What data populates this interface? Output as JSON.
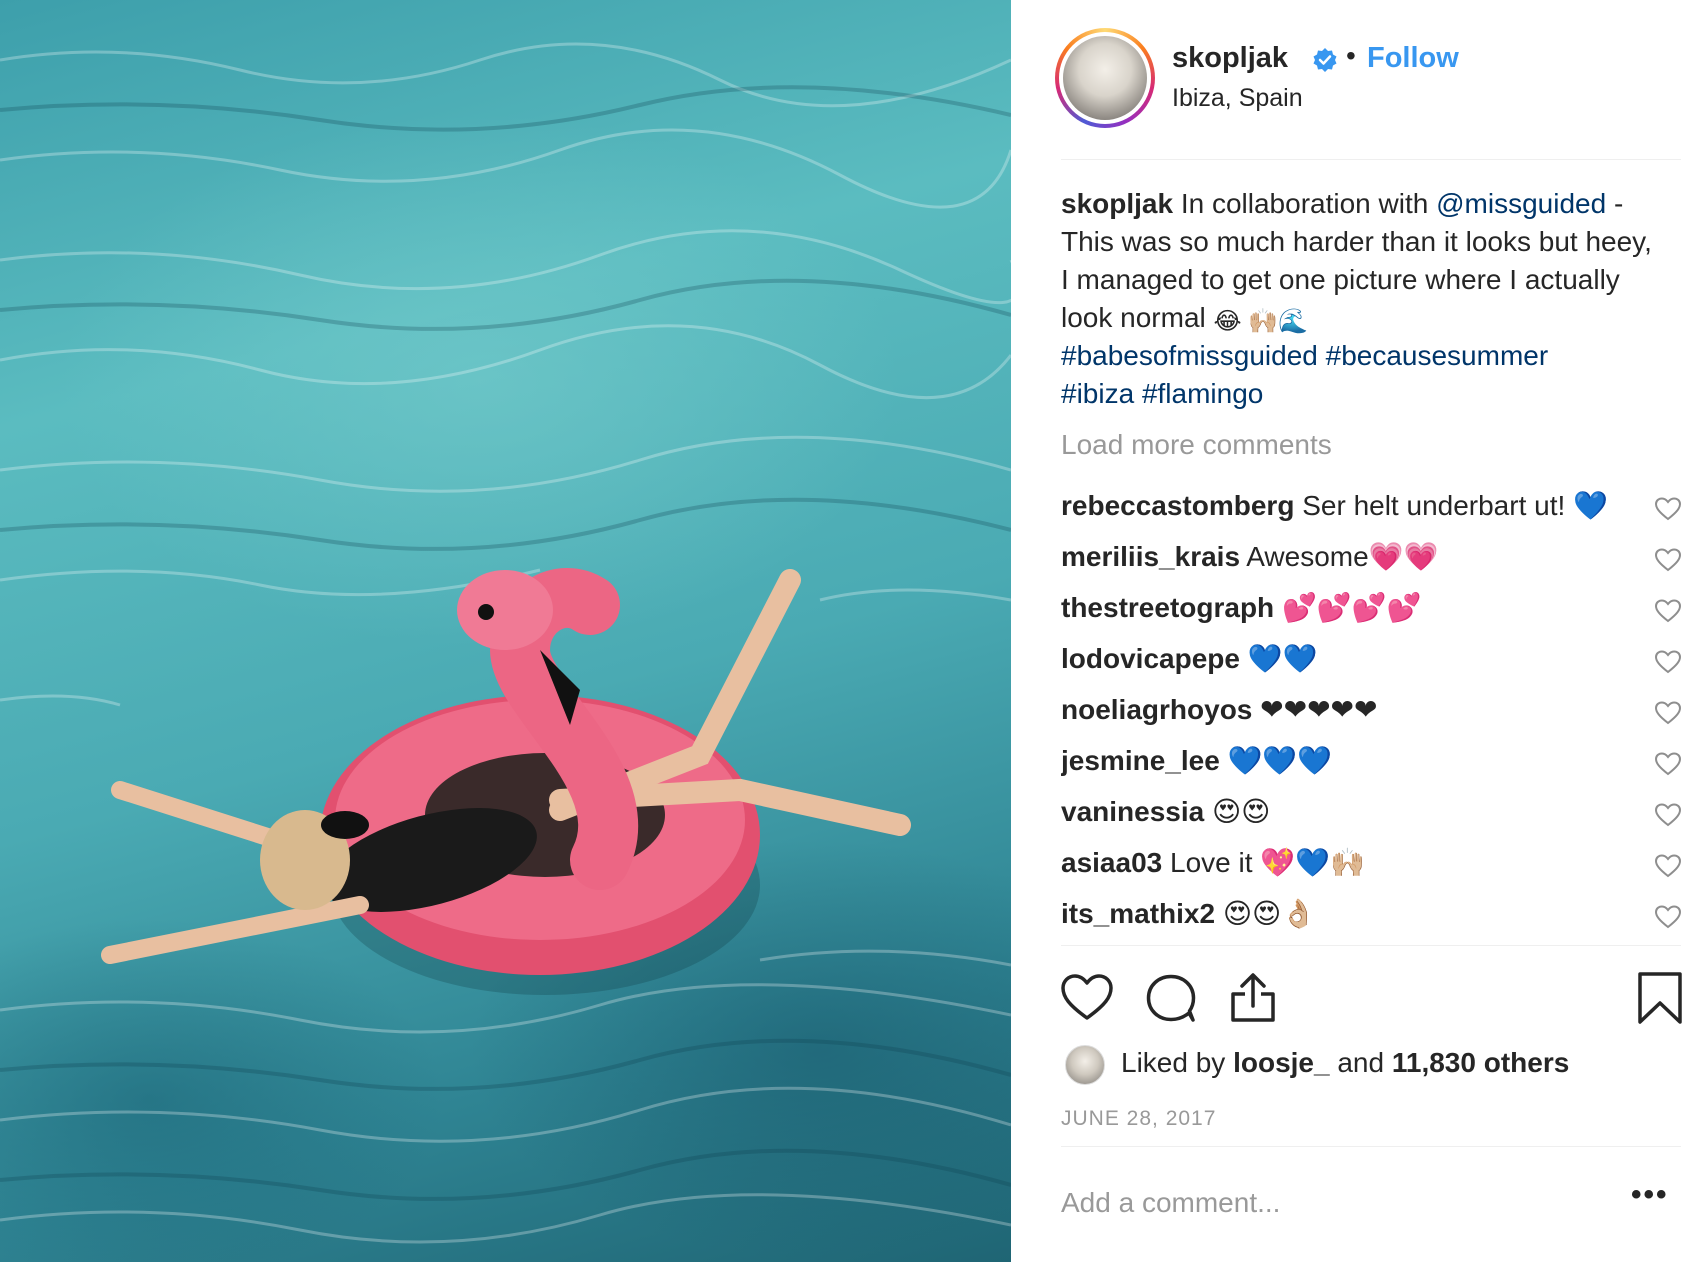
{
  "post": {
    "username": "skopljak",
    "follow_label": "Follow",
    "separator": "•",
    "location": "Ibiza, Spain"
  },
  "caption": {
    "username": "skopljak",
    "text_1": "In collaboration with ",
    "mention": "@missguided",
    "text_2": " - This was so much harder than it looks but heey, I managed to get one picture where I actually look normal ",
    "emojis": "😂 🙌🏼🌊",
    "hashtags": [
      "#babesofmissguided",
      "#becausesummer",
      "#ibiza",
      "#flamingo"
    ]
  },
  "load_more_label": "Load more comments",
  "comments": [
    {
      "user": "rebeccastomberg",
      "text": "Ser helt underbart ut! 💙"
    },
    {
      "user": "meriliis_krais",
      "text": "Awesome💗💗"
    },
    {
      "user": "thestreetograph",
      "text": "💕💕💕💕"
    },
    {
      "user": "lodovicapepe",
      "text": "💙💙"
    },
    {
      "user": "noeliagrhoyos",
      "text": "❤❤❤❤❤"
    },
    {
      "user": "jesmine_lee",
      "text": "💙💙💙"
    },
    {
      "user": "vaninessia",
      "text": "😍😍"
    },
    {
      "user": "asiaa03",
      "text": "Love it 💖💙🙌🏼"
    },
    {
      "user": "its_mathix2",
      "text": "😍😍👌🏼"
    }
  ],
  "likes": {
    "prefix": "Liked by ",
    "user": "loosje_",
    "middle": " and ",
    "count": "11,830 others"
  },
  "date": "JUNE 28, 2017",
  "add_comment_placeholder": "Add a comment...",
  "more_label": "•••",
  "colors": {
    "link": "#003569",
    "follow": "#3897f0",
    "muted": "#999999",
    "verified": "#3897f0"
  },
  "icons": [
    "heart-icon",
    "comment-icon",
    "share-icon",
    "bookmark-icon",
    "verified-badge-icon",
    "more-options-icon"
  ]
}
